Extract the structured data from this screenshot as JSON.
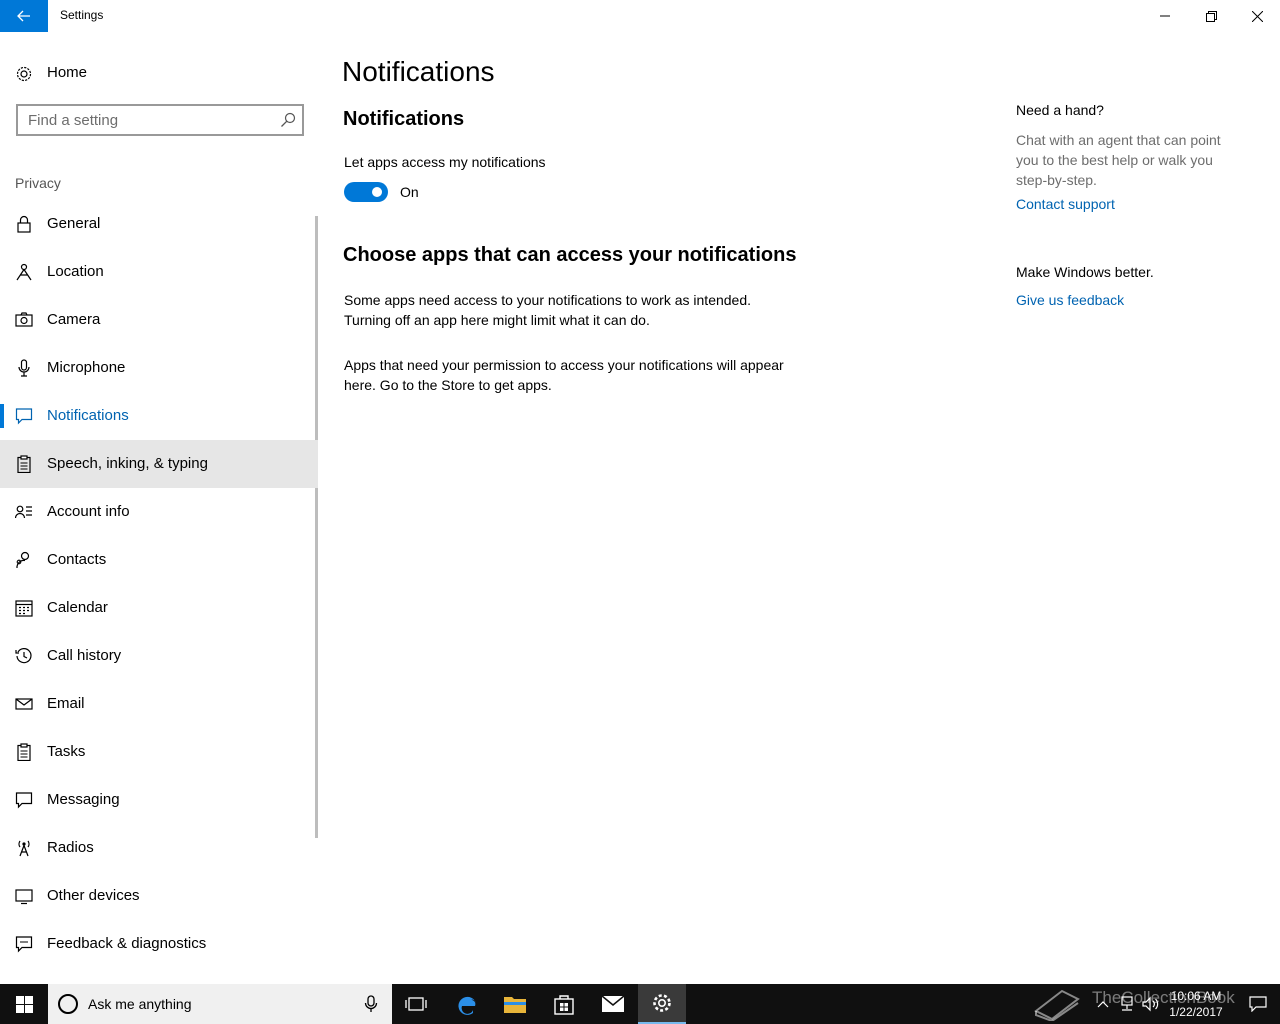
{
  "window": {
    "title": "Settings"
  },
  "sidebar": {
    "home_label": "Home",
    "search_placeholder": "Find a setting",
    "section_label": "Privacy",
    "items": [
      {
        "label": "General",
        "icon": "lock-icon"
      },
      {
        "label": "Location",
        "icon": "location-icon"
      },
      {
        "label": "Camera",
        "icon": "camera-icon"
      },
      {
        "label": "Microphone",
        "icon": "microphone-icon"
      },
      {
        "label": "Notifications",
        "icon": "notification-icon",
        "active": true
      },
      {
        "label": "Speech, inking, & typing",
        "icon": "clipboard-icon",
        "hover": true
      },
      {
        "label": "Account info",
        "icon": "account-info-icon"
      },
      {
        "label": "Contacts",
        "icon": "contacts-icon"
      },
      {
        "label": "Calendar",
        "icon": "calendar-icon"
      },
      {
        "label": "Call history",
        "icon": "history-icon"
      },
      {
        "label": "Email",
        "icon": "email-icon"
      },
      {
        "label": "Tasks",
        "icon": "tasks-icon"
      },
      {
        "label": "Messaging",
        "icon": "messaging-icon"
      },
      {
        "label": "Radios",
        "icon": "radio-icon"
      },
      {
        "label": "Other devices",
        "icon": "devices-icon"
      },
      {
        "label": "Feedback & diagnostics",
        "icon": "feedback-icon"
      }
    ]
  },
  "main": {
    "page_title": "Notifications",
    "subtitle": "Notifications",
    "toggle_label": "Let apps access my notifications",
    "toggle_state": "On",
    "section2_title": "Choose apps that can access your notifications",
    "para1": "Some apps need access to your notifications to work as intended. Turning off an app here might limit what it can do.",
    "para2": "Apps that need your permission to access your notifications will appear here. Go to the Store to get apps."
  },
  "help": {
    "heading": "Need a hand?",
    "text": "Chat with an agent that can point you to the best help or walk you step-by-step.",
    "link1": "Contact support",
    "heading2": "Make Windows better.",
    "link2": "Give us feedback"
  },
  "taskbar": {
    "search_text": "Ask me anything",
    "time": "10:06 AM",
    "date": "1/22/2017",
    "watermark": "TheCollectionBook"
  },
  "colors": {
    "accent": "#0078d7",
    "link": "#0063b1",
    "taskbar": "#101010"
  }
}
